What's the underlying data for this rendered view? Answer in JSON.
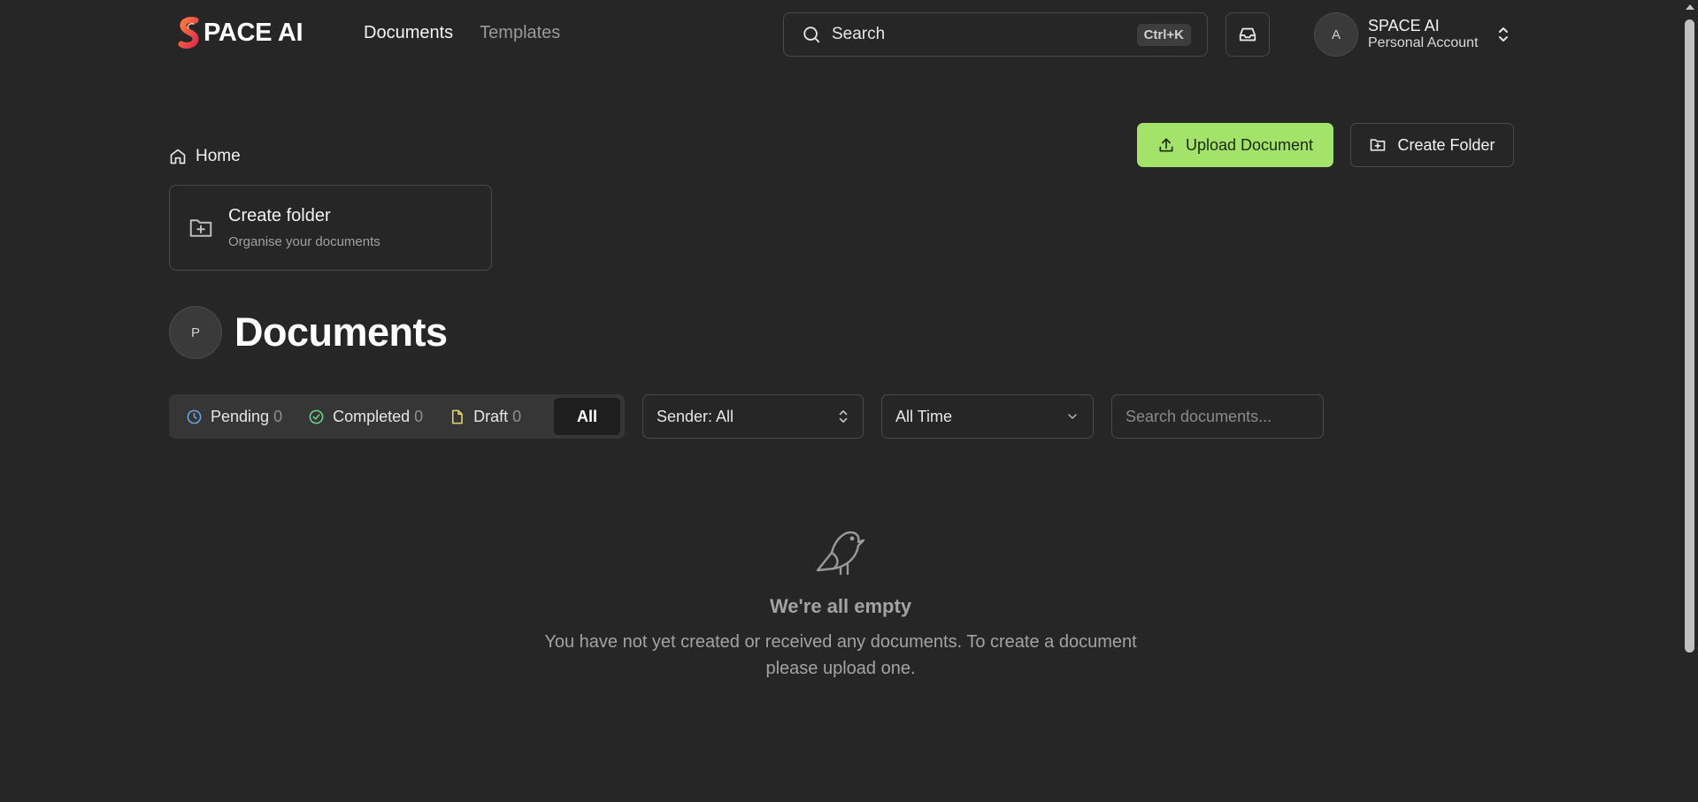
{
  "brand": {
    "name": "PACE AI",
    "accent": "#a3e36a"
  },
  "nav": {
    "documents": "Documents",
    "templates": "Templates"
  },
  "search": {
    "label": "Search",
    "shortcut": "Ctrl+K",
    "icon": "search-icon"
  },
  "account": {
    "initial": "A",
    "name": "SPACE AI",
    "type": "Personal Account"
  },
  "breadcrumb": {
    "home": "Home"
  },
  "actions": {
    "upload": "Upload Document",
    "create_folder": "Create Folder"
  },
  "folder_card": {
    "title": "Create folder",
    "subtitle": "Organise your documents"
  },
  "page": {
    "avatar_initial": "P",
    "title": "Documents"
  },
  "filters": {
    "tabs": [
      {
        "label": "Pending",
        "count": "0",
        "icon": "clock-icon",
        "color": "#6aa3e3"
      },
      {
        "label": "Completed",
        "count": "0",
        "icon": "check-circle-icon",
        "color": "#6ad389"
      },
      {
        "label": "Draft",
        "count": "0",
        "icon": "file-icon",
        "color": "#e6d36a"
      }
    ],
    "all_label": "All",
    "sender": "Sender: All",
    "time": "All Time",
    "search_placeholder": "Search documents..."
  },
  "empty_state": {
    "title": "We're all empty",
    "description": "You have not yet created or received any documents. To create a document please upload one."
  }
}
